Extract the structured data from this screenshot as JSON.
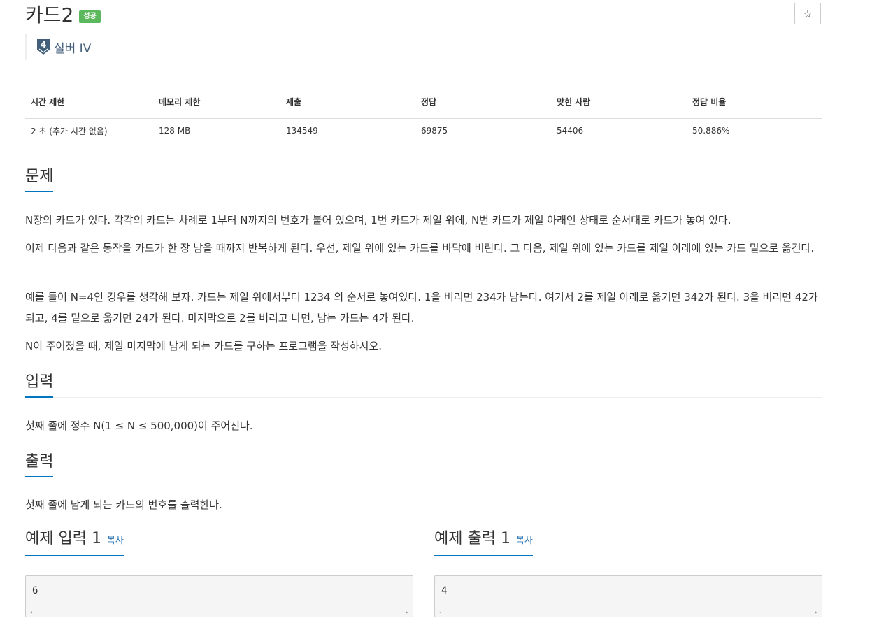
{
  "header": {
    "title": "카드2",
    "badge": "성공",
    "star_icon": "☆",
    "tier_number": "4",
    "tier_label": "실버 IV"
  },
  "info": {
    "headers": [
      "시간 제한",
      "메모리 제한",
      "제출",
      "정답",
      "맞힌 사람",
      "정답 비율"
    ],
    "values": [
      "2 초 (추가 시간 없음)",
      "128 MB",
      "134549",
      "69875",
      "54406",
      "50.886%"
    ]
  },
  "problem": {
    "heading": "문제",
    "paragraphs": [
      "N장의 카드가 있다. 각각의 카드는 차례로 1부터 N까지의 번호가 붙어 있으며, 1번 카드가 제일 위에, N번 카드가 제일 아래인 상태로 순서대로 카드가 놓여 있다.",
      "이제 다음과 같은 동작을 카드가 한 장 남을 때까지 반복하게 된다. 우선, 제일 위에 있는 카드를 바닥에 버린다. 그 다음, 제일 위에 있는 카드를 제일 아래에 있는 카드 밑으로 옮긴다.",
      "예를 들어 N=4인 경우를 생각해 보자. 카드는 제일 위에서부터 1234 의 순서로 놓여있다. 1을 버리면 234가 남는다. 여기서 2를 제일 아래로 옮기면 342가 된다. 3을 버리면 42가 되고, 4를 밑으로 옮기면 24가 된다. 마지막으로 2를 버리고 나면, 남는 카드는 4가 된다.",
      "N이 주어졌을 때, 제일 마지막에 남게 되는 카드를 구하는 프로그램을 작성하시오."
    ]
  },
  "input": {
    "heading": "입력",
    "text": "첫째 줄에 정수 N(1 ≤ N ≤ 500,000)이 주어진다."
  },
  "output": {
    "heading": "출력",
    "text": "첫째 줄에 남게 되는 카드의 번호를 출력한다."
  },
  "sample_input": {
    "heading": "예제 입력 1",
    "copy": "복사",
    "value": "6"
  },
  "sample_output": {
    "heading": "예제 출력 1",
    "copy": "복사",
    "value": "4"
  },
  "scroll": {
    "left": "◂",
    "right": "▸"
  },
  "colors": {
    "accent": "#0076c0",
    "success": "#5cb85c",
    "link": "#337ab7",
    "tier": "#435f7a"
  }
}
